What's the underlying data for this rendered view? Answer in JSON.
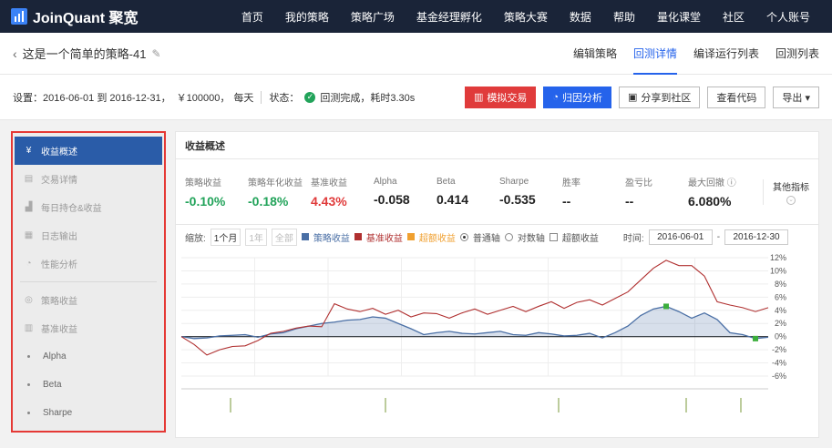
{
  "app": {
    "logo": "JoinQuant 聚宽"
  },
  "nav": [
    "首页",
    "我的策略",
    "策略广场",
    "基金经理孵化",
    "策略大赛",
    "数据",
    "帮助",
    "量化课堂",
    "社区",
    "个人账号"
  ],
  "titlebar": {
    "back": "‹",
    "title": "这是一个简单的策略-41",
    "tabs": [
      "编辑策略",
      "回测详情",
      "编译运行列表",
      "回测列表"
    ]
  },
  "settings": {
    "label": "设置：",
    "range": "2016-06-01 到 2016-12-31，",
    "capital": "￥100000，",
    "freq": "每天",
    "status_label": "状态：",
    "status_value": "回测完成，耗时3.30s",
    "buttons": {
      "sim": "模拟交易",
      "attr": "归因分析",
      "share": "分享到社区",
      "code": "查看代码",
      "export": "导出 ▾"
    }
  },
  "sidebar": {
    "top": [
      "收益概述",
      "交易详情",
      "每日持仓&收益",
      "日志输出",
      "性能分析"
    ],
    "bottom": [
      "策略收益",
      "基准收益"
    ],
    "sub": [
      "Alpha",
      "Beta",
      "Sharpe"
    ]
  },
  "content": {
    "header": "收益概述",
    "metrics": [
      {
        "label": "策略收益",
        "value": "-0.10%",
        "color": "green"
      },
      {
        "label": "策略年化收益",
        "value": "-0.18%",
        "color": "green"
      },
      {
        "label": "基准收益",
        "value": "4.43%",
        "color": "red"
      },
      {
        "label": "Alpha",
        "value": "-0.058",
        "color": "dark"
      },
      {
        "label": "Beta",
        "value": "0.414",
        "color": "dark"
      },
      {
        "label": "Sharpe",
        "value": "-0.535",
        "color": "dark"
      },
      {
        "label": "胜率",
        "value": "--",
        "color": "dark"
      },
      {
        "label": "盈亏比",
        "value": "--",
        "color": "dark"
      },
      {
        "label": "最大回撤",
        "value": "6.080%",
        "color": "dark"
      }
    ],
    "other_metrics": "其他指标",
    "controls": {
      "zoom_label": "缩放:",
      "zoom": [
        "1个月",
        "1年",
        "全部"
      ],
      "legend": [
        "策略收益",
        "基准收益",
        "超额收益"
      ],
      "scale": [
        "普通轴",
        "对数轴"
      ],
      "excess": "超额收益",
      "time_label": "时间:",
      "start": "2016-06-01",
      "end": "2016-12-30"
    }
  },
  "colors": {
    "strategy": "#4a6fa5",
    "benchmark": "#b03030",
    "excess": "#f0a030"
  },
  "chart_data": {
    "type": "line",
    "ylim": [
      -6,
      12
    ],
    "yticks": [
      "12%",
      "10%",
      "8%",
      "6%",
      "4%",
      "2%",
      "0%",
      "-2%",
      "-4%",
      "-6%"
    ],
    "series": [
      {
        "name": "策略收益",
        "values": [
          0,
          -0.3,
          -0.2,
          0.1,
          0.2,
          0.3,
          -0.1,
          0.4,
          0.6,
          1.2,
          1.6,
          2.0,
          2.2,
          2.5,
          2.6,
          3.0,
          2.8,
          2.0,
          1.2,
          0.3,
          0.6,
          0.8,
          0.5,
          0.4,
          0.6,
          0.8,
          0.3,
          0.2,
          0.6,
          0.4,
          0.1,
          0.2,
          0.5,
          -0.2,
          0.6,
          1.6,
          3.2,
          4.2,
          4.6,
          3.8,
          2.8,
          3.6,
          2.6,
          0.6,
          0.3,
          -0.3,
          -0.1
        ]
      },
      {
        "name": "基准收益",
        "values": [
          0,
          -1.2,
          -2.8,
          -2.0,
          -1.5,
          -1.4,
          -0.6,
          0.5,
          0.8,
          1.3,
          1.6,
          1.5,
          5.0,
          4.2,
          3.8,
          4.3,
          3.4,
          4.0,
          3.0,
          3.6,
          3.5,
          2.8,
          3.6,
          4.2,
          3.4,
          4.0,
          4.6,
          3.8,
          4.6,
          5.3,
          4.3,
          5.2,
          5.6,
          4.8,
          5.8,
          6.8,
          8.6,
          10.4,
          11.6,
          10.8,
          10.8,
          9.2,
          5.3,
          4.8,
          4.4,
          3.8,
          4.4
        ]
      }
    ]
  }
}
